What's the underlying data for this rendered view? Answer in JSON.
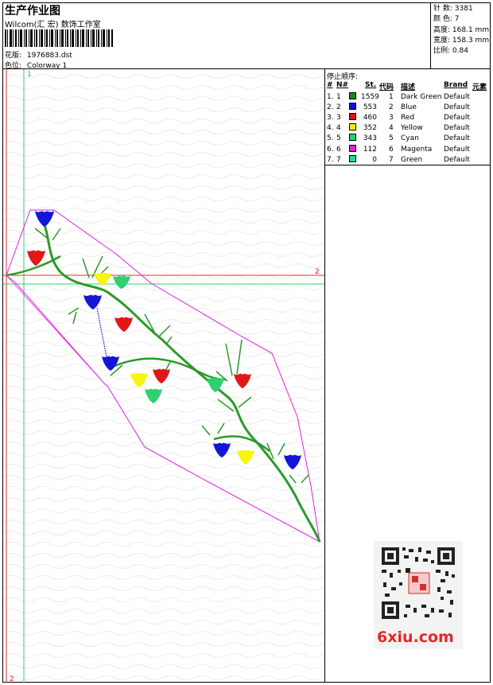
{
  "header": {
    "title": "生产作业图",
    "company": "Wilcom(汇 宏) 数饰工作室",
    "design_label": "花版:",
    "design_value": "1976883.dst",
    "colorway_label": "色位:",
    "colorway_value": "Colorway 1"
  },
  "stats": {
    "stitches_label": "针 数:",
    "stitches_value": "3381",
    "colors_label": "颜 色:",
    "colors_value": "7",
    "height_label": "高度:",
    "height_value": "168.1 mm",
    "width_label": "宽度:",
    "width_value": "158.3 mm",
    "scale_label": "比例:",
    "scale_value": "0.84"
  },
  "stop_sequence": {
    "title": "停止顺序:",
    "headers": [
      "#",
      "N#",
      "St.",
      "代码",
      "描述",
      "Brand",
      "元素"
    ],
    "rows": [
      {
        "idx": "1.",
        "n": "1",
        "st": "1559",
        "code": "1",
        "desc": "Dark Green",
        "brand": "Default",
        "color": "#1a8a1a"
      },
      {
        "idx": "2.",
        "n": "2",
        "st": "553",
        "code": "2",
        "desc": "Blue",
        "brand": "Default",
        "color": "#1010e0"
      },
      {
        "idx": "3.",
        "n": "3",
        "st": "460",
        "code": "3",
        "desc": "Red",
        "brand": "Default",
        "color": "#e01010"
      },
      {
        "idx": "4.",
        "n": "4",
        "st": "352",
        "code": "4",
        "desc": "Yellow",
        "brand": "Default",
        "color": "#f0f010"
      },
      {
        "idx": "5.",
        "n": "5",
        "st": "343",
        "code": "5",
        "desc": "Cyan",
        "brand": "Default",
        "color": "#20d080"
      },
      {
        "idx": "6.",
        "n": "6",
        "st": "112",
        "code": "6",
        "desc": "Magenta",
        "brand": "Default",
        "color": "#e020e0"
      },
      {
        "idx": "7.",
        "n": "7",
        "st": "0",
        "code": "7",
        "desc": "Green",
        "brand": "Default",
        "color": "#20e080"
      }
    ]
  },
  "canvas": {
    "marker_top": "1",
    "marker_right": "2",
    "marker_bottom": "2"
  },
  "watermark": "6xiu.com"
}
